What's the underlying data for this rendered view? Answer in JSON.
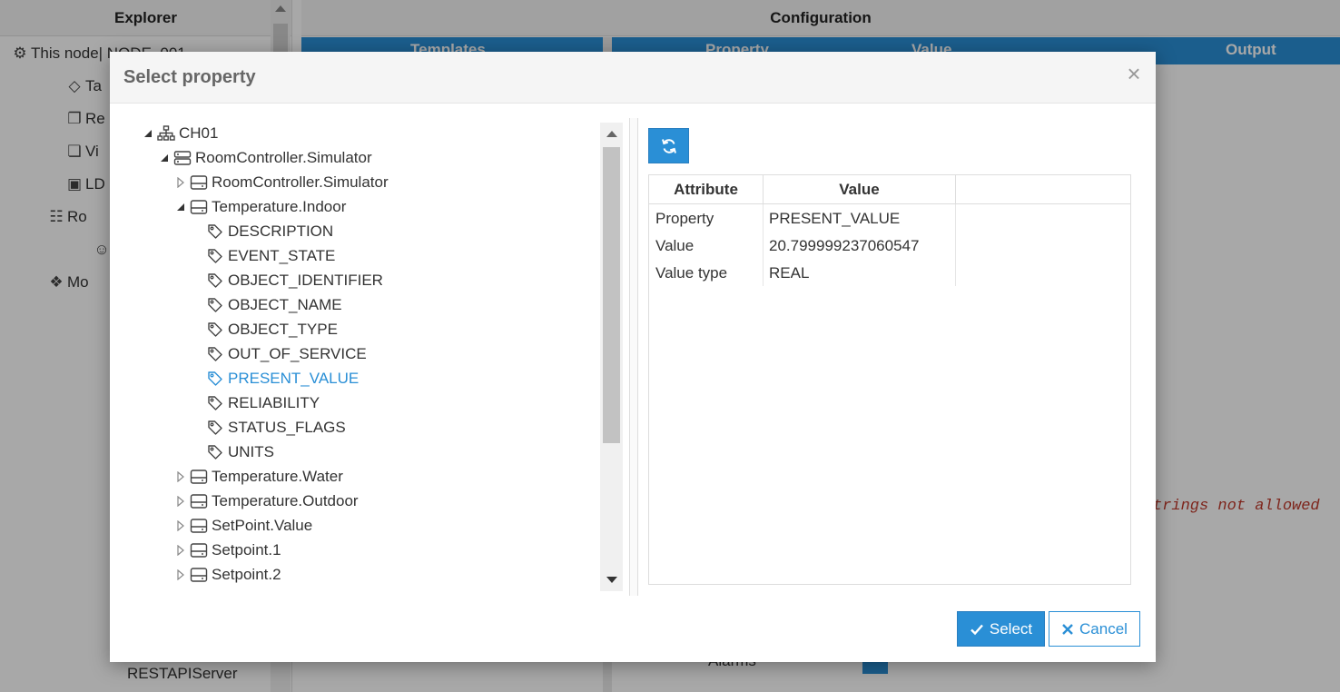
{
  "background": {
    "explorer_title": "Explorer",
    "configuration_title": "Configuration",
    "tab_templates": "Templates",
    "tab_property": "Property",
    "tab_value": "Value",
    "tab_output": "Output",
    "tree_items": [
      {
        "label": "This node| NODE_001",
        "icon": "gears-icon"
      },
      {
        "label": "Ta",
        "icon": "tags-icon"
      },
      {
        "label": "Re",
        "icon": "copy-icon"
      },
      {
        "label": "Vi",
        "icon": "windows-icon"
      },
      {
        "label": "LD",
        "icon": "contact-icon"
      },
      {
        "label": "Ro",
        "icon": "users-icon"
      },
      {
        "label": "",
        "icon": "user-icon"
      },
      {
        "label": "Mo",
        "icon": "cubes-icon"
      }
    ],
    "bottom_item": "RESTAPIServer",
    "error_text": "trings not allowed",
    "alarms_label": "Alarms"
  },
  "dialog": {
    "title": "Select property",
    "close_symbol": "×",
    "tree": [
      {
        "label": "CH01",
        "level": 0,
        "expander": "expanded",
        "icon": "sitemap-icon"
      },
      {
        "label": "RoomController.Simulator",
        "level": 1,
        "expander": "expanded",
        "icon": "server-icon"
      },
      {
        "label": "RoomController.Simulator",
        "level": 2,
        "expander": "collapsed",
        "icon": "device-icon"
      },
      {
        "label": "Temperature.Indoor",
        "level": 2,
        "expander": "expanded",
        "icon": "device-icon"
      },
      {
        "label": "DESCRIPTION",
        "level": 3,
        "expander": "none",
        "icon": "tag-icon"
      },
      {
        "label": "EVENT_STATE",
        "level": 3,
        "expander": "none",
        "icon": "tag-icon"
      },
      {
        "label": "OBJECT_IDENTIFIER",
        "level": 3,
        "expander": "none",
        "icon": "tag-icon"
      },
      {
        "label": "OBJECT_NAME",
        "level": 3,
        "expander": "none",
        "icon": "tag-icon"
      },
      {
        "label": "OBJECT_TYPE",
        "level": 3,
        "expander": "none",
        "icon": "tag-icon"
      },
      {
        "label": "OUT_OF_SERVICE",
        "level": 3,
        "expander": "none",
        "icon": "tag-icon"
      },
      {
        "label": "PRESENT_VALUE",
        "level": 3,
        "expander": "none",
        "icon": "tag-icon",
        "selected": true
      },
      {
        "label": "RELIABILITY",
        "level": 3,
        "expander": "none",
        "icon": "tag-icon"
      },
      {
        "label": "STATUS_FLAGS",
        "level": 3,
        "expander": "none",
        "icon": "tag-icon"
      },
      {
        "label": "UNITS",
        "level": 3,
        "expander": "none",
        "icon": "tag-icon"
      },
      {
        "label": "Temperature.Water",
        "level": 2,
        "expander": "collapsed",
        "icon": "device-icon"
      },
      {
        "label": "Temperature.Outdoor",
        "level": 2,
        "expander": "collapsed",
        "icon": "device-icon"
      },
      {
        "label": "SetPoint.Value",
        "level": 2,
        "expander": "collapsed",
        "icon": "device-icon"
      },
      {
        "label": "Setpoint.1",
        "level": 2,
        "expander": "collapsed",
        "icon": "device-icon"
      },
      {
        "label": "Setpoint.2",
        "level": 2,
        "expander": "collapsed",
        "icon": "device-icon"
      }
    ],
    "attributes": {
      "headers": {
        "attribute": "Attribute",
        "value": "Value"
      },
      "rows": [
        {
          "attribute": "Property",
          "value": "PRESENT_VALUE"
        },
        {
          "attribute": "Value",
          "value": "20.799999237060547"
        },
        {
          "attribute": "Value type",
          "value": "REAL"
        }
      ]
    },
    "buttons": {
      "select": "Select",
      "cancel": "Cancel"
    },
    "colors": {
      "accent": "#2a8fd6",
      "selected_text": "#2a8fd6"
    }
  }
}
